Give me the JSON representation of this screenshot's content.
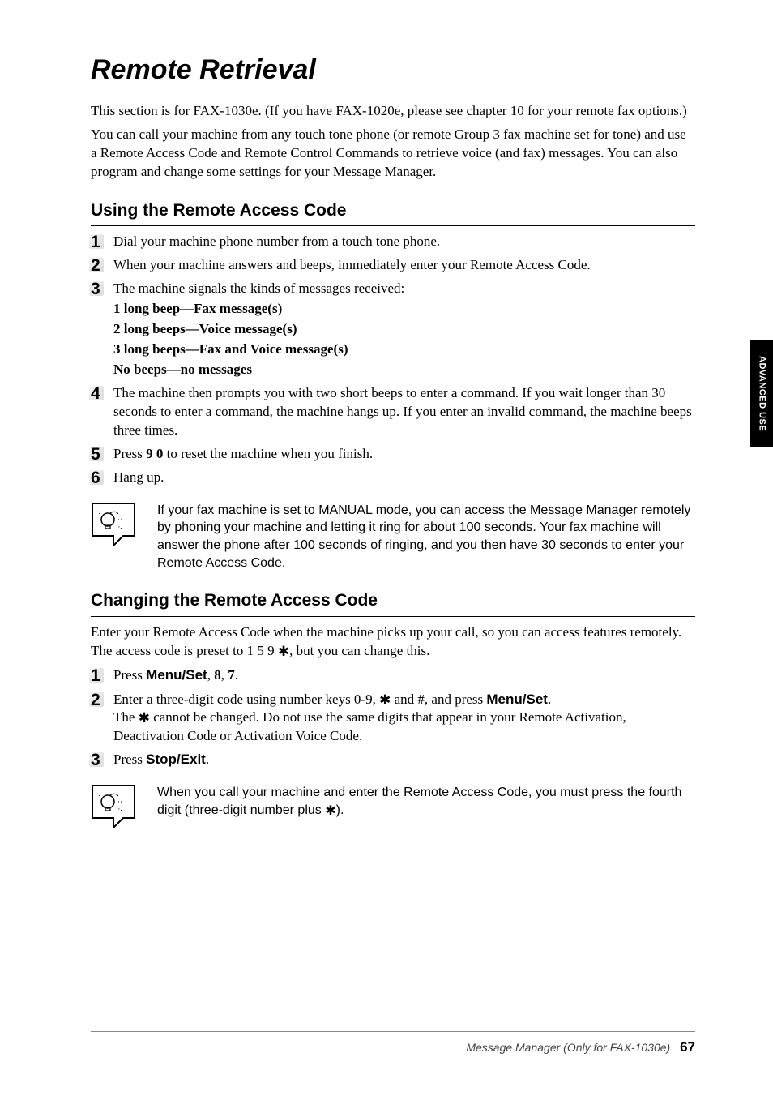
{
  "title": "Remote Retrieval",
  "intro": {
    "p1": "This section is for FAX-1030e. (If you have FAX-1020e, please see chapter 10 for your remote fax options.)",
    "p2": "You can call your machine from any touch tone phone (or remote Group 3 fax machine set for tone) and use a Remote Access Code and Remote Control Commands to retrieve voice (and fax) messages. You can also program and change some settings for your Message Manager."
  },
  "section1": {
    "heading": "Using the Remote Access Code",
    "steps": {
      "s1": {
        "num": "1",
        "text": "Dial your machine phone number from a touch tone phone."
      },
      "s2": {
        "num": "2",
        "text": "When your machine answers and beeps, immediately enter your Remote Access Code."
      },
      "s3": {
        "num": "3",
        "lead": "The machine signals the kinds of messages received:",
        "b1": "1 long beep—Fax message(s)",
        "b2": "2 long beeps—Voice message(s)",
        "b3": "3 long beeps—Fax and Voice message(s)",
        "b4": "No beeps—no messages"
      },
      "s4": {
        "num": "4",
        "text": "The machine then prompts you with two short beeps to enter a command. If you wait longer than 30 seconds to enter a command, the machine hangs up. If you enter an invalid command, the machine beeps three times."
      },
      "s5": {
        "num": "5",
        "pre": "Press ",
        "bold": "9 0",
        "post": " to reset the machine when you finish."
      },
      "s6": {
        "num": "6",
        "text": "Hang up."
      }
    },
    "note": "If your fax machine is set to MANUAL mode, you can access the Message Manager remotely by phoning your machine and letting it ring for about 100 seconds. Your fax machine will answer the phone after 100 seconds of ringing, and you then have 30 seconds to enter your Remote Access Code."
  },
  "section2": {
    "heading": "Changing the Remote Access Code",
    "intro_a": "Enter your Remote Access Code when the machine picks up your call, so you can access features remotely. The access code is preset to 1 5 9 ",
    "intro_b": ", but you can change this.",
    "steps": {
      "s1": {
        "num": "1",
        "pre": "Press ",
        "bold1": "Menu/Set",
        "mid": ", ",
        "bold2": "8",
        "mid2": ", ",
        "bold3": "7",
        "post": "."
      },
      "s2": {
        "num": "2",
        "line1_a": "Enter a three-digit code using number keys 0-9, ",
        "line1_b": " and #, and press ",
        "line1_bold": "Menu/Set",
        "line1_c": ".",
        "line2_a": "The ",
        "line2_b": " cannot be changed. Do not use the same digits that appear in your Remote Activation, Deactivation Code or Activation Voice Code."
      },
      "s3": {
        "num": "3",
        "pre": "Press ",
        "bold": "Stop/Exit",
        "post": "."
      }
    },
    "note_a": "When you call your machine and enter the Remote Access Code, you must press the fourth digit (three-digit number plus ",
    "note_b": ")."
  },
  "sidetab": "ADVANCED USE",
  "footer": {
    "text": "Message Manager (Only for FAX-1030e)",
    "page": "67"
  },
  "star": "✱"
}
